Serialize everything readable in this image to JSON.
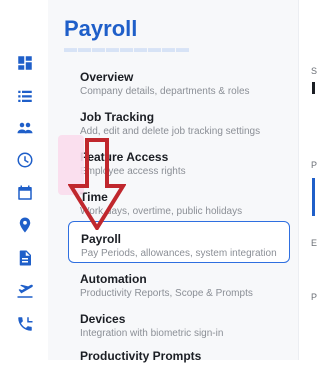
{
  "rail": {
    "icons": [
      "dashboard-icon",
      "list-icon",
      "people-icon",
      "clock-icon",
      "calendar-icon",
      "location-pin-icon",
      "document-icon",
      "plane-icon",
      "phone-icon"
    ]
  },
  "panel": {
    "title": "Payroll",
    "items": [
      {
        "label": "Overview",
        "desc": "Company details, departments & roles"
      },
      {
        "label": "Job Tracking",
        "desc": "Add, edit and delete job tracking settings"
      },
      {
        "label": "Feature Access",
        "desc": "Employee access rights"
      },
      {
        "label": "Time",
        "desc": "Work days, overtime, public holidays"
      },
      {
        "label": "Payroll",
        "desc": "Pay Periods, allowances, system integration"
      },
      {
        "label": "Automation",
        "desc": "Productivity Reports, Scope & Prompts"
      },
      {
        "label": "Devices",
        "desc": "Integration with biometric sign-in"
      },
      {
        "label": "Productivity Prompts",
        "desc": ""
      }
    ],
    "active_index": 4
  },
  "right_pane": {
    "glyphs": [
      "S",
      "P",
      "E",
      "P"
    ]
  },
  "colors": {
    "accent": "#1f5fc9",
    "arrow": "#c0272d"
  }
}
